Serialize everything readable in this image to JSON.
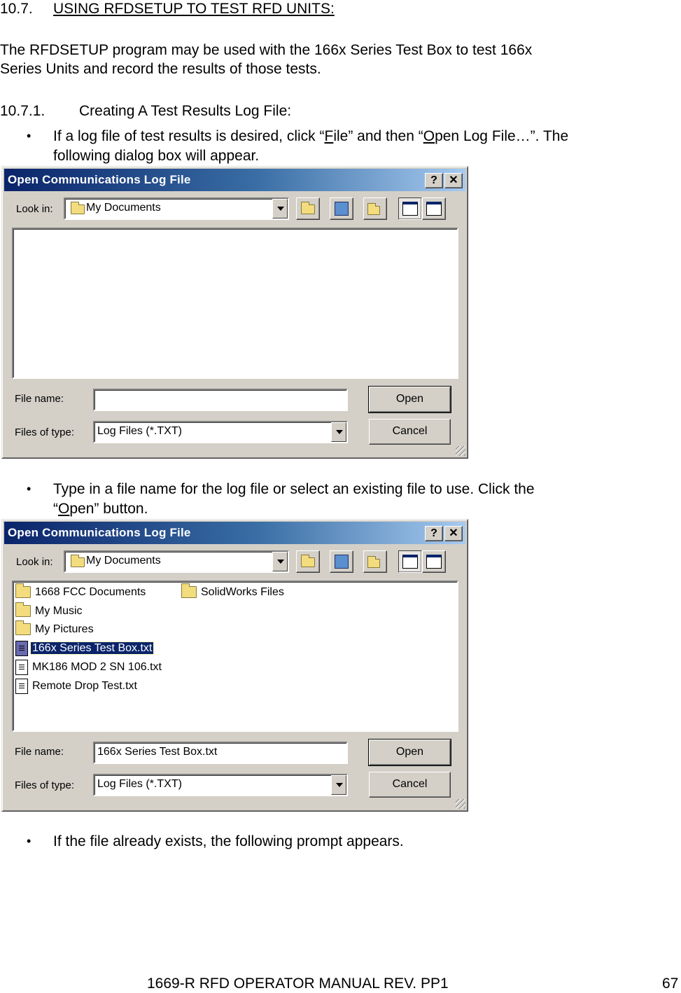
{
  "section": {
    "number": "10.7.",
    "title": "USING RFDSETUP TO TEST RFD UNITS:",
    "intro_line1": "The RFDSETUP program may be used with the 166x Series Test Box to test 166x",
    "intro_line2": "Series Units and record the results of those tests."
  },
  "subsection": {
    "number": "10.7.1.",
    "title": "Creating A Test Results Log File:"
  },
  "bullets": [
    {
      "line1_prefix": "If a log file of test results is desired, click “",
      "line1_u1": "F",
      "line1_mid1": "ile” and then “",
      "line1_u2": "O",
      "line1_suffix": "pen Log File…”.  The",
      "line2": "following dialog box will appear."
    },
    {
      "line1": "Type in a file name for the log file or select an existing file to use.  Click the",
      "line2_prefix": "“",
      "line2_u": "O",
      "line2_suffix": "pen” button."
    },
    {
      "line1": "If the file already exists, the following prompt appears."
    }
  ],
  "dialogs": [
    {
      "title": "Open Communications Log File",
      "help_glyph": "?",
      "close_glyph": "✕",
      "look_in_label": "Look in:",
      "look_in_value": "My Documents",
      "file_name_label": "File name:",
      "file_name_value": "",
      "files_of_type_label": "Files of type:",
      "files_of_type_value": "Log Files (*.TXT)",
      "open_label": "Open",
      "cancel_label": "Cancel",
      "items": []
    },
    {
      "title": "Open Communications Log File",
      "help_glyph": "?",
      "close_glyph": "✕",
      "look_in_label": "Look in:",
      "look_in_value": "My Documents",
      "file_name_label": "File name:",
      "file_name_value": "166x Series Test Box.txt",
      "files_of_type_label": "Files of type:",
      "files_of_type_value": "Log Files (*.TXT)",
      "open_label": "Open",
      "cancel_label": "Cancel",
      "items": [
        {
          "name": "1668 FCC Documents",
          "type": "folder"
        },
        {
          "name": "My Music",
          "type": "folder"
        },
        {
          "name": "My Pictures",
          "type": "folder"
        },
        {
          "name": "166x Series Test Box.txt",
          "type": "text-file",
          "selected": true
        },
        {
          "name": "MK186 MOD 2 SN 106.txt",
          "type": "text-file"
        },
        {
          "name": "Remote Drop Test.txt",
          "type": "text-file"
        },
        {
          "name": "SolidWorks Files",
          "type": "folder-shortcut"
        }
      ]
    }
  ],
  "footer": {
    "title": "1669-R RFD OPERATOR MANUAL REV. PP1",
    "page_number": "67"
  }
}
